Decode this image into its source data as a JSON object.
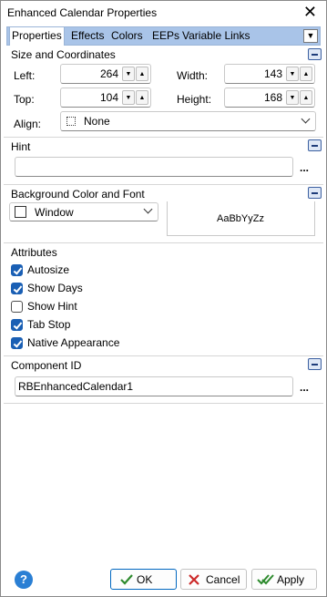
{
  "window": {
    "title": "Enhanced Calendar Properties",
    "close_glyph": "✕"
  },
  "tabs": [
    {
      "label": "Properties",
      "active": true
    },
    {
      "label": "Effects",
      "active": false
    },
    {
      "label": "Colors",
      "active": false
    },
    {
      "label": "EEPs",
      "active": false
    },
    {
      "label": "Variable Links",
      "active": false
    }
  ],
  "tab_menu_glyph": "▼",
  "size_section": {
    "title": "Size and Coordinates",
    "left_label": "Left:",
    "left_value": "264",
    "top_label": "Top:",
    "top_value": "104",
    "width_label": "Width:",
    "width_value": "143",
    "height_label": "Height:",
    "height_value": "168",
    "align_label": "Align:",
    "align_value": "None",
    "spin_down_glyph": "▼",
    "spin_up_glyph": "▲"
  },
  "hint_section": {
    "title": "Hint",
    "value": "",
    "ellipsis": "..."
  },
  "background_section": {
    "title": "Background Color and Font",
    "color_value": "Window",
    "font_preview": "AaBbYyZz"
  },
  "attributes_section": {
    "title": "Attributes",
    "items": [
      {
        "label": "Autosize",
        "checked": true
      },
      {
        "label": "Show Days",
        "checked": true
      },
      {
        "label": "Show Hint",
        "checked": false
      },
      {
        "label": "Tab Stop",
        "checked": true
      },
      {
        "label": "Native Appearance",
        "checked": true
      }
    ]
  },
  "component_section": {
    "title": "Component ID",
    "value": "RBEnhancedCalendar1",
    "ellipsis": "..."
  },
  "footer": {
    "help_glyph": "?",
    "ok_label": "OK",
    "cancel_label": "Cancel",
    "apply_label": "Apply"
  },
  "colors": {
    "accent": "#1a5fb4",
    "tab_strip": "#a9c4e8",
    "help": "#2a7fd4",
    "ok_check": "#2e8b2e",
    "cancel_x": "#cc2a2a"
  }
}
